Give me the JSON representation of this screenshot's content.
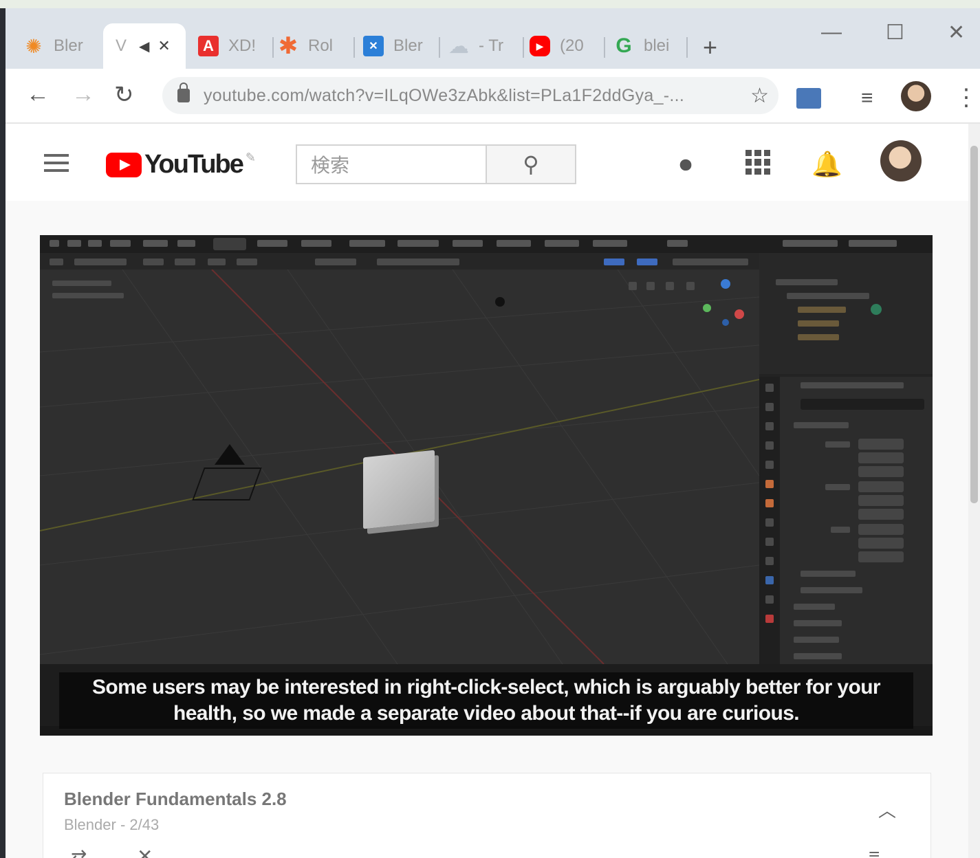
{
  "browser": {
    "tabs": [
      {
        "label": "Bler",
        "favicon": "blender-icon",
        "color": "#f08a24"
      },
      {
        "label": "V",
        "favicon": "",
        "color": ""
      },
      {
        "label": "XD!",
        "favicon": "adobe-icon",
        "color": "#e9302e"
      },
      {
        "label": "Rol",
        "favicon": "asterisk-icon",
        "color": "#f06a35"
      },
      {
        "label": "Bler",
        "favicon": "xd-icon",
        "color": "#2b7fd8"
      },
      {
        "label": "- Tr",
        "favicon": "cloud-icon",
        "color": "#bdc6d0"
      },
      {
        "label": "(20",
        "favicon": "youtube-icon",
        "color": "#ff0000"
      },
      {
        "label": "blei",
        "favicon": "google-icon",
        "color": "#34a853"
      }
    ],
    "url": "youtube.com/watch?v=ILqOWe3zAbk&list=PLa1F2ddGya_-...",
    "controls": {
      "minimize": "—",
      "maximize": "☐",
      "close": "✕",
      "newtab": "+",
      "tab_close": "✕",
      "tab_audio": "◀"
    }
  },
  "youtube": {
    "logo_text": "YouTube",
    "search_placeholder": "検索",
    "video": {
      "subtitle_line1": "Some users may be interested in right-click-select, which is arguably better for your",
      "subtitle_line2": "health, so we made a separate video about that--if you are curious."
    },
    "playlist": {
      "title": "Blender Fundamentals 2.8",
      "meta": "Blender - 2/43"
    }
  },
  "colors": {
    "youtube_red": "#ff0000",
    "blender_bg": "#2f2f2f"
  }
}
